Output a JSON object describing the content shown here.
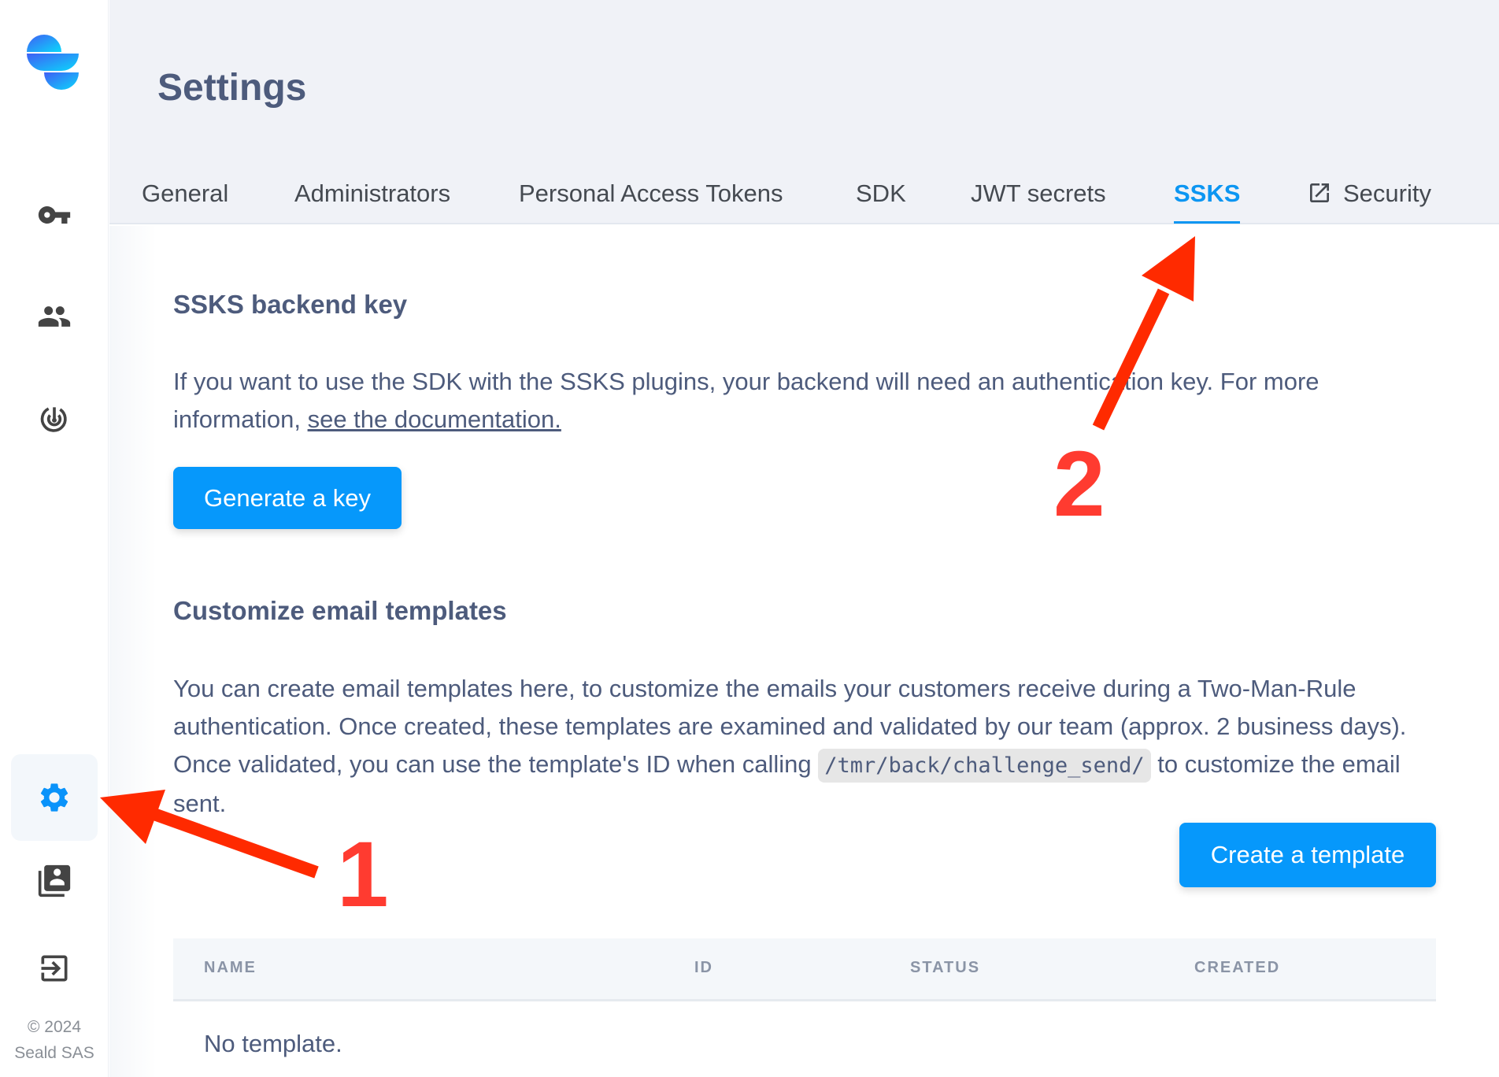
{
  "sidebar": {
    "logo": "seald-logo",
    "items": [
      {
        "name": "key-icon",
        "label": "API keys"
      },
      {
        "name": "users-icon",
        "label": "Users"
      },
      {
        "name": "radar-icon",
        "label": "Monitoring"
      },
      {
        "name": "gear-icon",
        "label": "Settings",
        "active": true
      },
      {
        "name": "contacts-icon",
        "label": "Contacts"
      },
      {
        "name": "logout-icon",
        "label": "Log out"
      }
    ],
    "copyright_line1": "© 2024",
    "copyright_line2": "Seald SAS"
  },
  "header": {
    "title": "Settings",
    "tabs": [
      {
        "label": "General"
      },
      {
        "label": "Administrators"
      },
      {
        "label": "Personal Access Tokens"
      },
      {
        "label": "SDK"
      },
      {
        "label": "JWT secrets"
      },
      {
        "label": "SSKS",
        "active": true
      },
      {
        "label": "Security",
        "icon": "external-link-icon"
      }
    ]
  },
  "ssks": {
    "heading": "SSKS backend key",
    "text": "If you want to use the SDK with the SSKS plugins, your backend will need an authentication key. For more information, ",
    "link": "see the documentation.",
    "button": "Generate a key"
  },
  "templates": {
    "heading": "Customize email templates",
    "text_before": "You can create email templates here, to customize the emails your customers receive during a Two-Man-Rule authentication. Once created, these templates are examined and validated by our team (approx. 2 business days). Once validated, you can use the template's ID when calling ",
    "code": "/tmr/back/challenge_send/",
    "text_after": " to customize the email sent.",
    "button": "Create a template",
    "columns": [
      "NAME",
      "ID",
      "STATUS",
      "CREATED"
    ],
    "empty": "No template."
  },
  "annotations": {
    "step1": "1",
    "step2": "2",
    "color": "#ff2a00"
  },
  "colors": {
    "accent": "#0698fb",
    "text": "#4d5b7c",
    "header_bg": "#f0f2f7"
  }
}
